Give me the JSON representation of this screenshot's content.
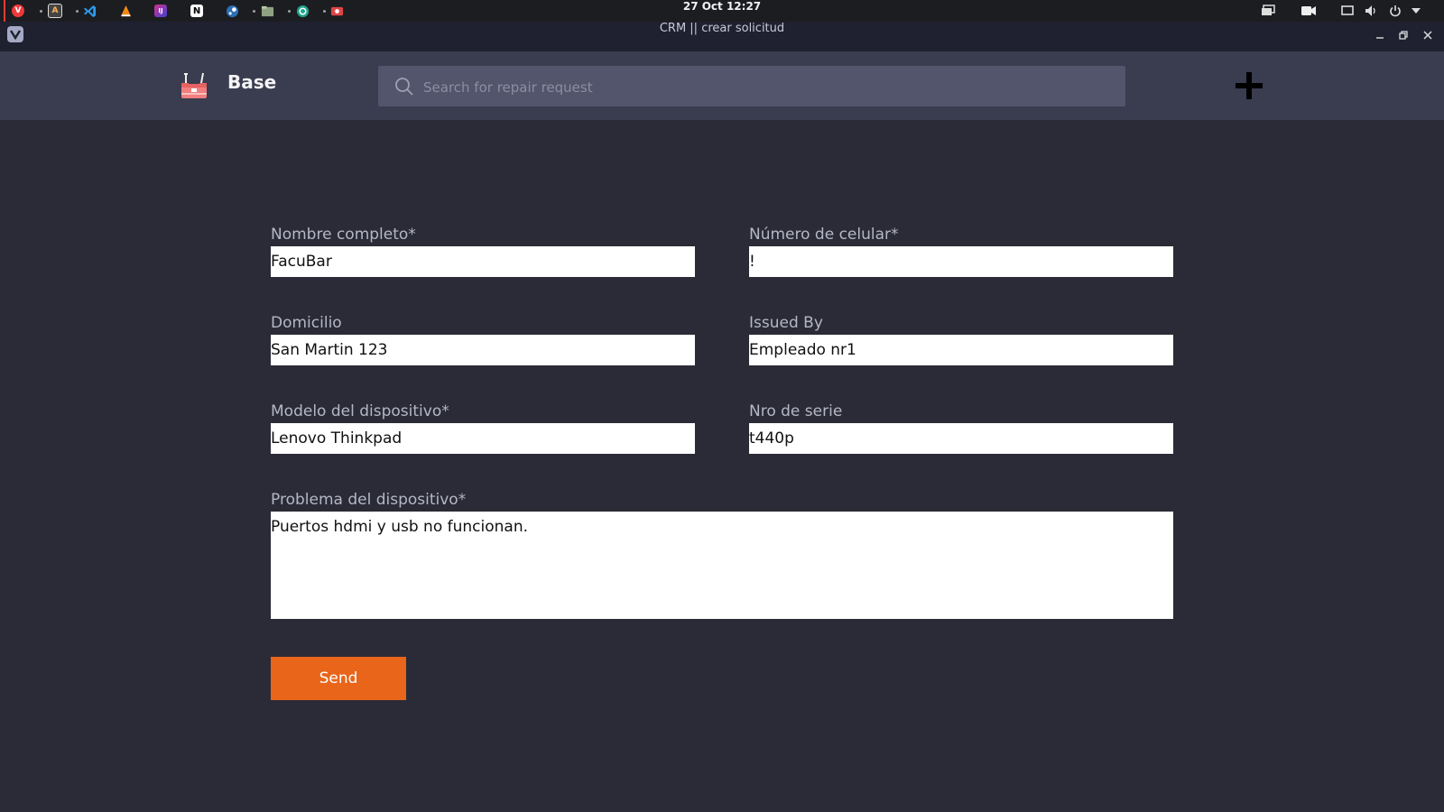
{
  "os": {
    "clock": "27 Oct  12:27",
    "launcher_icons": [
      "vivaldi-icon",
      "font-viewer-icon",
      "vscode-icon",
      "vlc-icon",
      "jetbrains-icon",
      "notion-icon",
      "steam-icon",
      "files-icon",
      "git-client-icon",
      "recorder-icon"
    ],
    "tray_icons": [
      "display-icon",
      "camera-icon",
      "screen-icon",
      "volume-icon",
      "power-icon",
      "chevron-down-icon"
    ]
  },
  "window": {
    "title": "CRM || crear solicitud"
  },
  "header": {
    "brand": "Base",
    "search_placeholder": "Search for repair request",
    "add_icon": "plus-icon"
  },
  "form": {
    "nombre": {
      "label": "Nombre completo*",
      "value": "FacuBar"
    },
    "celular": {
      "label": "Número de celular*",
      "value": "!"
    },
    "domicilio": {
      "label": "Domicilio",
      "value": "San Martin 123"
    },
    "issued_by": {
      "label": "Issued By",
      "value": "Empleado nr1"
    },
    "modelo": {
      "label": "Modelo del dispositivo*",
      "value": "Lenovo Thinkpad"
    },
    "serie": {
      "label": "Nro de serie",
      "value": "t440p"
    },
    "problema": {
      "label": "Problema del dispositivo*",
      "value": "Puertos hdmi y usb no funcionan."
    },
    "send_label": "Send"
  },
  "colors": {
    "accent": "#e8651a",
    "background": "#2b2b37",
    "header": "#3a3c4f",
    "search": "#52556b"
  }
}
